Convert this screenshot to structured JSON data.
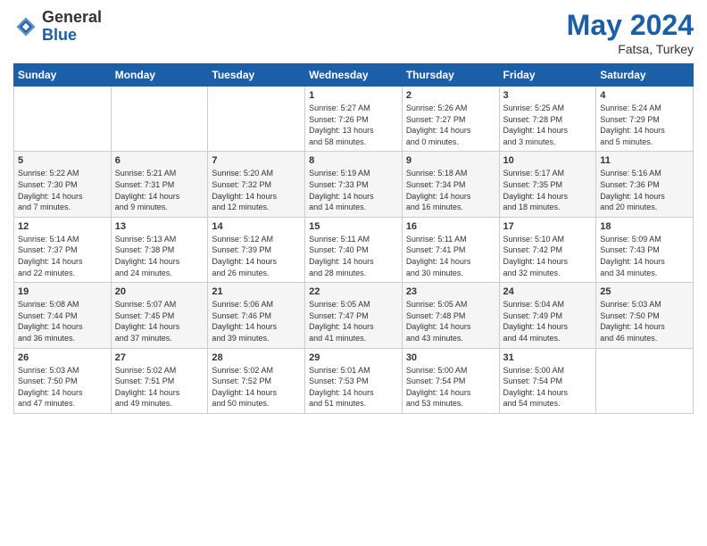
{
  "header": {
    "logo_general": "General",
    "logo_blue": "Blue",
    "month_year": "May 2024",
    "location": "Fatsa, Turkey"
  },
  "days_of_week": [
    "Sunday",
    "Monday",
    "Tuesday",
    "Wednesday",
    "Thursday",
    "Friday",
    "Saturday"
  ],
  "weeks": [
    [
      {
        "day": "",
        "info": ""
      },
      {
        "day": "",
        "info": ""
      },
      {
        "day": "",
        "info": ""
      },
      {
        "day": "1",
        "info": "Sunrise: 5:27 AM\nSunset: 7:26 PM\nDaylight: 13 hours\nand 58 minutes."
      },
      {
        "day": "2",
        "info": "Sunrise: 5:26 AM\nSunset: 7:27 PM\nDaylight: 14 hours\nand 0 minutes."
      },
      {
        "day": "3",
        "info": "Sunrise: 5:25 AM\nSunset: 7:28 PM\nDaylight: 14 hours\nand 3 minutes."
      },
      {
        "day": "4",
        "info": "Sunrise: 5:24 AM\nSunset: 7:29 PM\nDaylight: 14 hours\nand 5 minutes."
      }
    ],
    [
      {
        "day": "5",
        "info": "Sunrise: 5:22 AM\nSunset: 7:30 PM\nDaylight: 14 hours\nand 7 minutes."
      },
      {
        "day": "6",
        "info": "Sunrise: 5:21 AM\nSunset: 7:31 PM\nDaylight: 14 hours\nand 9 minutes."
      },
      {
        "day": "7",
        "info": "Sunrise: 5:20 AM\nSunset: 7:32 PM\nDaylight: 14 hours\nand 12 minutes."
      },
      {
        "day": "8",
        "info": "Sunrise: 5:19 AM\nSunset: 7:33 PM\nDaylight: 14 hours\nand 14 minutes."
      },
      {
        "day": "9",
        "info": "Sunrise: 5:18 AM\nSunset: 7:34 PM\nDaylight: 14 hours\nand 16 minutes."
      },
      {
        "day": "10",
        "info": "Sunrise: 5:17 AM\nSunset: 7:35 PM\nDaylight: 14 hours\nand 18 minutes."
      },
      {
        "day": "11",
        "info": "Sunrise: 5:16 AM\nSunset: 7:36 PM\nDaylight: 14 hours\nand 20 minutes."
      }
    ],
    [
      {
        "day": "12",
        "info": "Sunrise: 5:14 AM\nSunset: 7:37 PM\nDaylight: 14 hours\nand 22 minutes."
      },
      {
        "day": "13",
        "info": "Sunrise: 5:13 AM\nSunset: 7:38 PM\nDaylight: 14 hours\nand 24 minutes."
      },
      {
        "day": "14",
        "info": "Sunrise: 5:12 AM\nSunset: 7:39 PM\nDaylight: 14 hours\nand 26 minutes."
      },
      {
        "day": "15",
        "info": "Sunrise: 5:11 AM\nSunset: 7:40 PM\nDaylight: 14 hours\nand 28 minutes."
      },
      {
        "day": "16",
        "info": "Sunrise: 5:11 AM\nSunset: 7:41 PM\nDaylight: 14 hours\nand 30 minutes."
      },
      {
        "day": "17",
        "info": "Sunrise: 5:10 AM\nSunset: 7:42 PM\nDaylight: 14 hours\nand 32 minutes."
      },
      {
        "day": "18",
        "info": "Sunrise: 5:09 AM\nSunset: 7:43 PM\nDaylight: 14 hours\nand 34 minutes."
      }
    ],
    [
      {
        "day": "19",
        "info": "Sunrise: 5:08 AM\nSunset: 7:44 PM\nDaylight: 14 hours\nand 36 minutes."
      },
      {
        "day": "20",
        "info": "Sunrise: 5:07 AM\nSunset: 7:45 PM\nDaylight: 14 hours\nand 37 minutes."
      },
      {
        "day": "21",
        "info": "Sunrise: 5:06 AM\nSunset: 7:46 PM\nDaylight: 14 hours\nand 39 minutes."
      },
      {
        "day": "22",
        "info": "Sunrise: 5:05 AM\nSunset: 7:47 PM\nDaylight: 14 hours\nand 41 minutes."
      },
      {
        "day": "23",
        "info": "Sunrise: 5:05 AM\nSunset: 7:48 PM\nDaylight: 14 hours\nand 43 minutes."
      },
      {
        "day": "24",
        "info": "Sunrise: 5:04 AM\nSunset: 7:49 PM\nDaylight: 14 hours\nand 44 minutes."
      },
      {
        "day": "25",
        "info": "Sunrise: 5:03 AM\nSunset: 7:50 PM\nDaylight: 14 hours\nand 46 minutes."
      }
    ],
    [
      {
        "day": "26",
        "info": "Sunrise: 5:03 AM\nSunset: 7:50 PM\nDaylight: 14 hours\nand 47 minutes."
      },
      {
        "day": "27",
        "info": "Sunrise: 5:02 AM\nSunset: 7:51 PM\nDaylight: 14 hours\nand 49 minutes."
      },
      {
        "day": "28",
        "info": "Sunrise: 5:02 AM\nSunset: 7:52 PM\nDaylight: 14 hours\nand 50 minutes."
      },
      {
        "day": "29",
        "info": "Sunrise: 5:01 AM\nSunset: 7:53 PM\nDaylight: 14 hours\nand 51 minutes."
      },
      {
        "day": "30",
        "info": "Sunrise: 5:00 AM\nSunset: 7:54 PM\nDaylight: 14 hours\nand 53 minutes."
      },
      {
        "day": "31",
        "info": "Sunrise: 5:00 AM\nSunset: 7:54 PM\nDaylight: 14 hours\nand 54 minutes."
      },
      {
        "day": "",
        "info": ""
      }
    ]
  ]
}
